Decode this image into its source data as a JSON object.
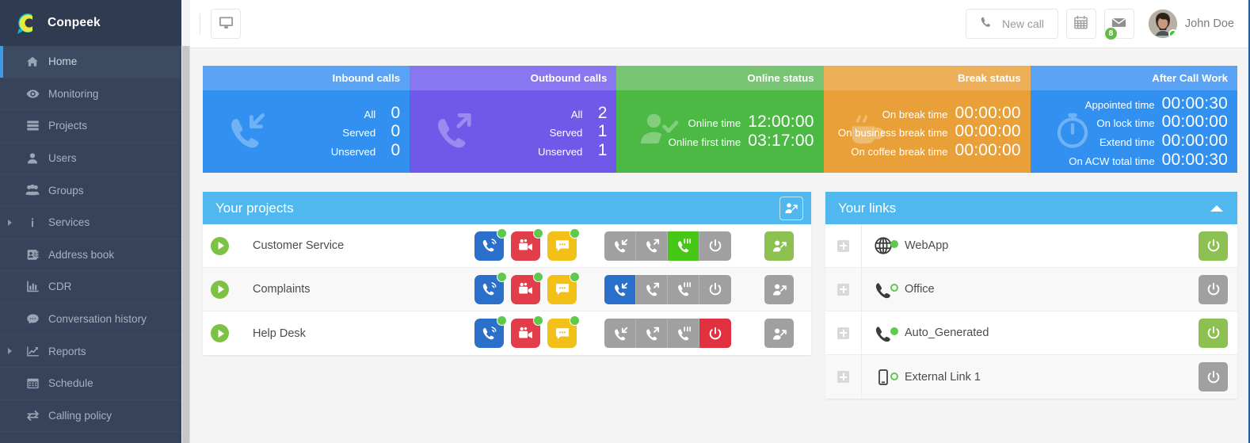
{
  "brand": {
    "name": "Conpeek",
    "logo_icon": "conpeek-logo"
  },
  "sidebar": {
    "items": [
      {
        "label": "Home",
        "icon": "home-icon",
        "active": true,
        "expandable": false
      },
      {
        "label": "Monitoring",
        "icon": "eye-icon",
        "active": false,
        "expandable": false
      },
      {
        "label": "Projects",
        "icon": "server-icon",
        "active": false,
        "expandable": false
      },
      {
        "label": "Users",
        "icon": "user-icon",
        "active": false,
        "expandable": false
      },
      {
        "label": "Groups",
        "icon": "users-icon",
        "active": false,
        "expandable": false
      },
      {
        "label": "Services",
        "icon": "info-icon",
        "active": false,
        "expandable": true
      },
      {
        "label": "Address book",
        "icon": "address-book-icon",
        "active": false,
        "expandable": false
      },
      {
        "label": "CDR",
        "icon": "bar-chart-icon",
        "active": false,
        "expandable": false
      },
      {
        "label": "Conversation history",
        "icon": "comment-icon",
        "active": false,
        "expandable": false
      },
      {
        "label": "Reports",
        "icon": "line-chart-icon",
        "active": false,
        "expandable": true
      },
      {
        "label": "Schedule",
        "icon": "calendar-icon",
        "active": false,
        "expandable": false
      },
      {
        "label": "Calling policy",
        "icon": "exchange-icon",
        "active": false,
        "expandable": false
      }
    ]
  },
  "topbar": {
    "screen_icon": "desktop-icon",
    "new_call_label": "New call",
    "new_call_icon": "phone-icon",
    "calendar_icon": "calendar-icon",
    "mail_icon": "envelope-icon",
    "mail_badge": "8",
    "user_name": "John Doe",
    "avatar_icon": "avatar",
    "status_icon": "online-dot"
  },
  "cards": [
    {
      "title": "Inbound calls",
      "icon": "phone-incoming-icon",
      "theme": "c-inbound",
      "rows": [
        {
          "label": "All",
          "value": "0"
        },
        {
          "label": "Served",
          "value": "0"
        },
        {
          "label": "Unserved",
          "value": "0"
        }
      ]
    },
    {
      "title": "Outbound calls",
      "icon": "phone-outgoing-icon",
      "theme": "c-outbound",
      "rows": [
        {
          "label": "All",
          "value": "2"
        },
        {
          "label": "Served",
          "value": "1"
        },
        {
          "label": "Unserved",
          "value": "1"
        }
      ]
    },
    {
      "title": "Online status",
      "icon": "user-check-icon",
      "theme": "c-online",
      "rows": [
        {
          "label": "Online time",
          "value": "12:00:00"
        },
        {
          "label": "Online first time",
          "value": "03:17:00"
        }
      ]
    },
    {
      "title": "Break status",
      "icon": "coffee-icon",
      "theme": "c-break",
      "rows": [
        {
          "label": "On break time",
          "value": "00:00:00"
        },
        {
          "label": "On business break time",
          "value": "00:00:00"
        },
        {
          "label": "On coffee break time",
          "value": "00:00:00"
        }
      ]
    },
    {
      "title": "After Call Work",
      "icon": "stopwatch-icon",
      "theme": "c-acw",
      "rows": [
        {
          "label": "Appointed time",
          "value": "00:00:30"
        },
        {
          "label": "On lock time",
          "value": "00:00:00"
        },
        {
          "label": "Extend time",
          "value": "00:00:00"
        },
        {
          "label": "On ACW total time",
          "value": "00:00:30"
        }
      ]
    }
  ],
  "projects_panel": {
    "title": "Your projects",
    "header_button_icon": "agent-transfer-icon",
    "rows": [
      {
        "name": "Customer Service",
        "play_icon": "play-icon",
        "channels": [
          {
            "icon": "phone-ring-icon",
            "color": "blue",
            "online": true
          },
          {
            "icon": "video-camera-icon",
            "color": "red",
            "online": true
          },
          {
            "icon": "chat-icon",
            "color": "yellow",
            "online": true
          }
        ],
        "segments": [
          {
            "icon": "phone-incoming-icon",
            "state": "grey"
          },
          {
            "icon": "phone-outgoing-icon",
            "state": "grey"
          },
          {
            "icon": "phone-active-icon",
            "state": "green"
          },
          {
            "icon": "power-icon",
            "state": "grey"
          }
        ],
        "action": {
          "icon": "agent-transfer-icon",
          "state": "green"
        }
      },
      {
        "name": "Complaints",
        "play_icon": "play-icon",
        "channels": [
          {
            "icon": "phone-ring-icon",
            "color": "blue",
            "online": true
          },
          {
            "icon": "video-camera-icon",
            "color": "red",
            "online": true
          },
          {
            "icon": "chat-icon",
            "color": "yellow",
            "online": true
          }
        ],
        "segments": [
          {
            "icon": "phone-incoming-icon",
            "state": "blue"
          },
          {
            "icon": "phone-outgoing-icon",
            "state": "grey"
          },
          {
            "icon": "phone-active-icon",
            "state": "grey"
          },
          {
            "icon": "power-icon",
            "state": "grey"
          }
        ],
        "action": {
          "icon": "agent-transfer-icon",
          "state": "grey"
        }
      },
      {
        "name": "Help Desk",
        "play_icon": "play-icon",
        "channels": [
          {
            "icon": "phone-ring-icon",
            "color": "blue",
            "online": true
          },
          {
            "icon": "video-camera-icon",
            "color": "red",
            "online": true
          },
          {
            "icon": "chat-icon",
            "color": "yellow",
            "online": true
          }
        ],
        "segments": [
          {
            "icon": "phone-incoming-icon",
            "state": "grey"
          },
          {
            "icon": "phone-outgoing-icon",
            "state": "grey"
          },
          {
            "icon": "phone-active-icon",
            "state": "grey"
          },
          {
            "icon": "power-icon",
            "state": "red"
          }
        ],
        "action": {
          "icon": "agent-transfer-icon",
          "state": "grey"
        }
      }
    ]
  },
  "links_panel": {
    "title": "Your links",
    "collapse_icon": "caret-up-icon",
    "rows": [
      {
        "name": "WebApp",
        "icon": "globe-icon",
        "dot": "filled",
        "power": "green",
        "expand_icon": "plus-icon"
      },
      {
        "name": "Office",
        "icon": "phone-ring-icon",
        "dot": "hollow",
        "power": "grey",
        "expand_icon": "plus-icon"
      },
      {
        "name": "Auto_Generated",
        "icon": "phone-ring-icon",
        "dot": "filled",
        "power": "green",
        "expand_icon": "plus-icon"
      },
      {
        "name": "External Link 1",
        "icon": "mobile-icon",
        "dot": "hollow",
        "power": "grey",
        "expand_icon": "plus-icon"
      }
    ]
  },
  "colors": {
    "sidebar_bg": "#36435a",
    "accent_blue": "#50b8ee",
    "green": "#8cc152",
    "inbound": "#3291f0",
    "outbound": "#7059e8",
    "online": "#4cb944",
    "break": "#e9a038"
  }
}
